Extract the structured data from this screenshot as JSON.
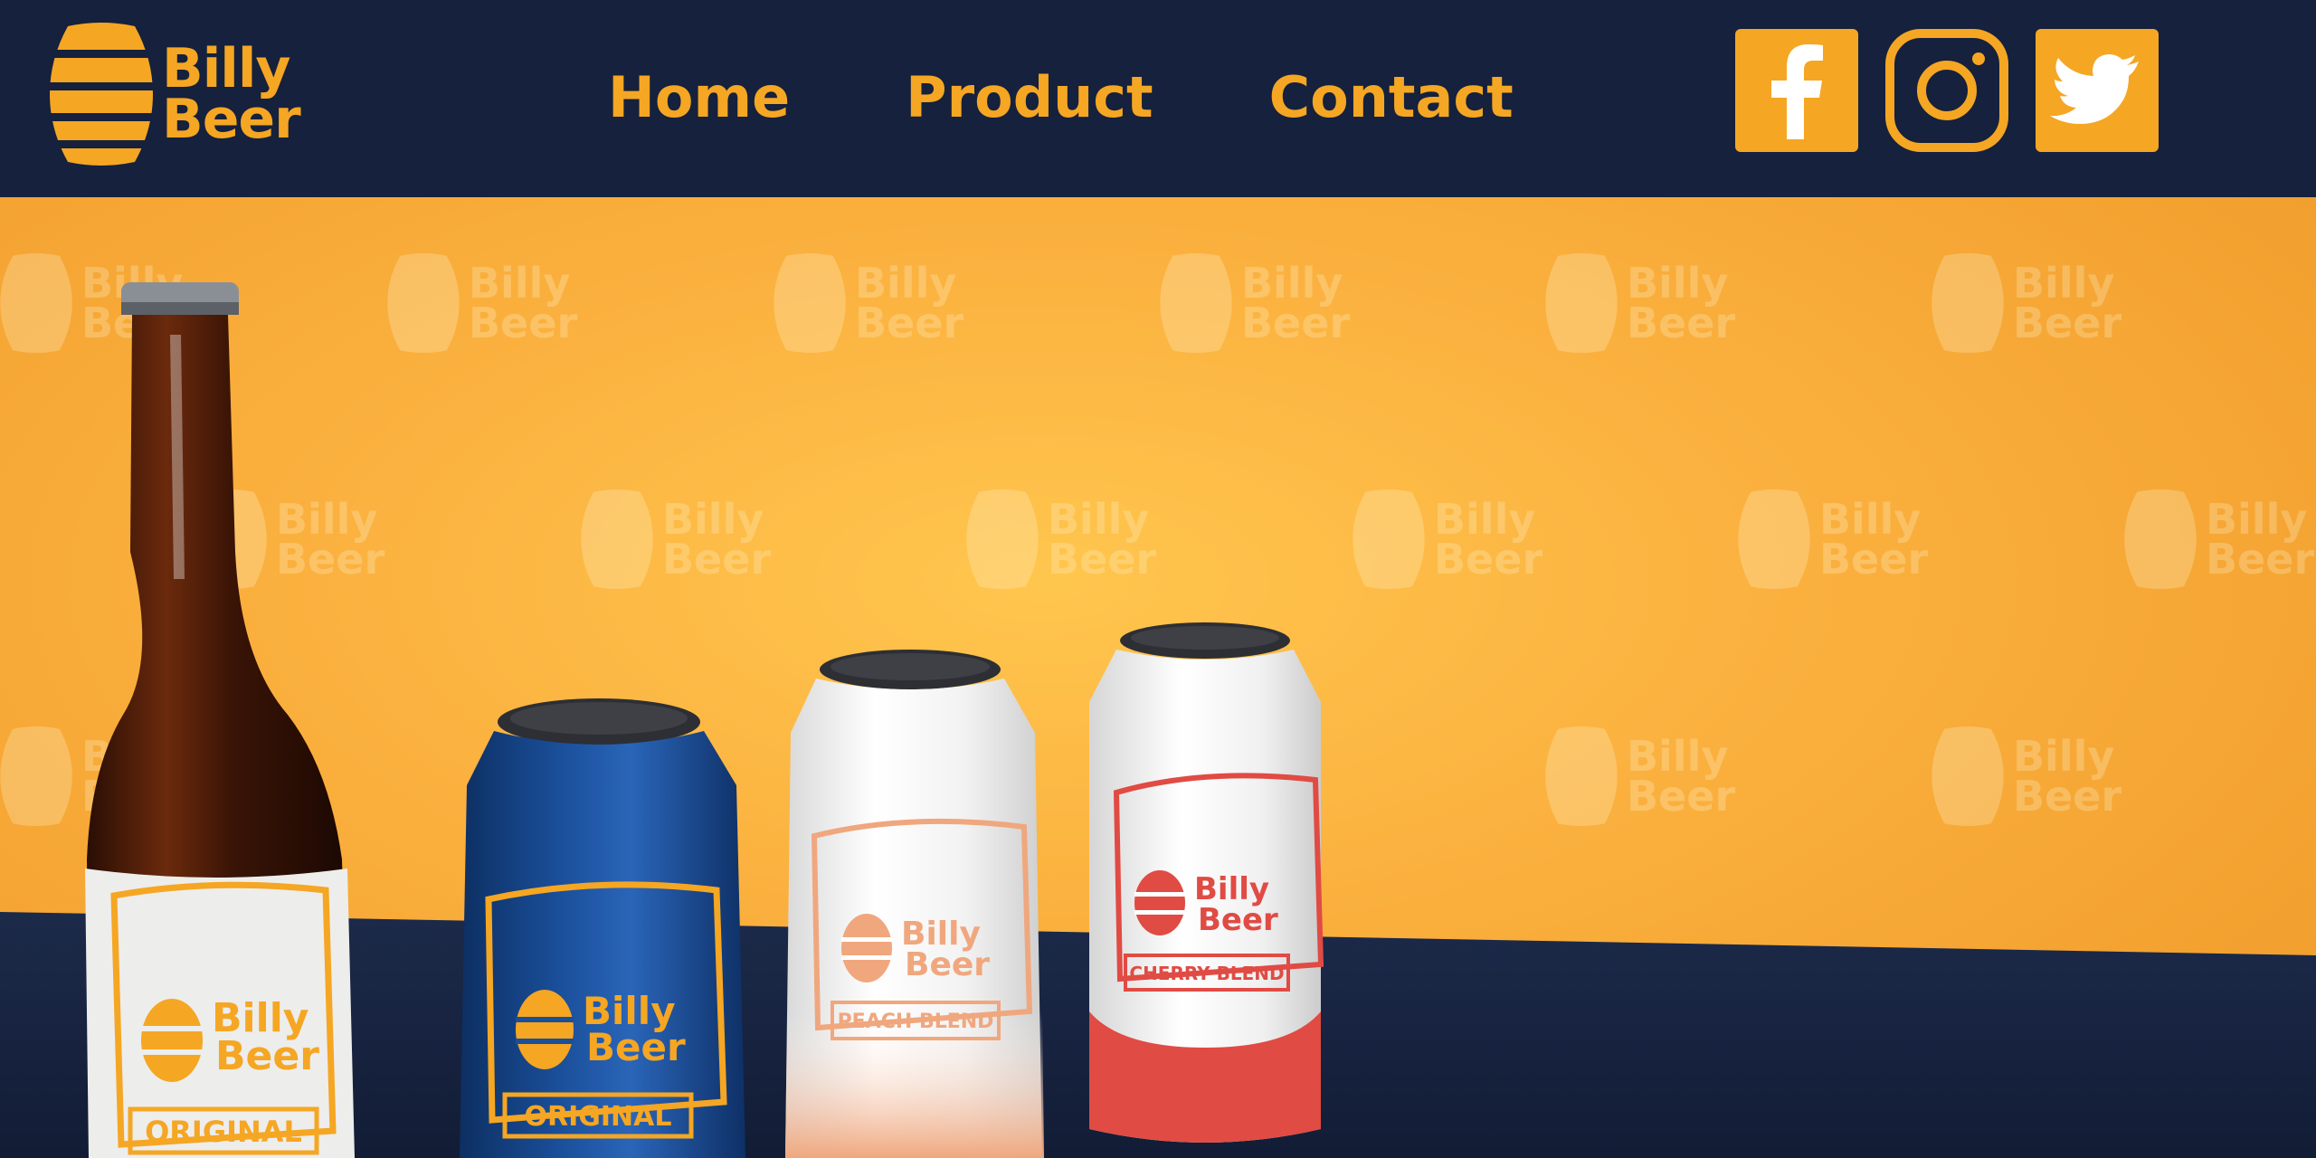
{
  "brand": {
    "line1": "Billy",
    "line2": "Beer"
  },
  "nav": {
    "home": "Home",
    "product": "Product",
    "contact": "Contact"
  },
  "social": {
    "facebook": "facebook-icon",
    "instagram": "instagram-icon",
    "twitter": "twitter-icon"
  },
  "hero": {
    "products": [
      {
        "kind": "bottle",
        "brand1": "Billy",
        "brand2": "Beer",
        "variant": "ORIGINAL"
      },
      {
        "kind": "can",
        "brand1": "Billy",
        "brand2": "Beer",
        "variant": "ORIGINAL"
      },
      {
        "kind": "can",
        "brand1": "Billy",
        "brand2": "Beer",
        "variant": "PEACH BLEND"
      },
      {
        "kind": "can",
        "brand1": "Billy",
        "brand2": "Beer",
        "variant": "CHERRY BLEND"
      }
    ]
  },
  "colors": {
    "navy": "#15213d",
    "orange": "#f5a623",
    "blue_can": "#15478f",
    "cherry": "#e04b44",
    "peach": "#f0a77e"
  }
}
